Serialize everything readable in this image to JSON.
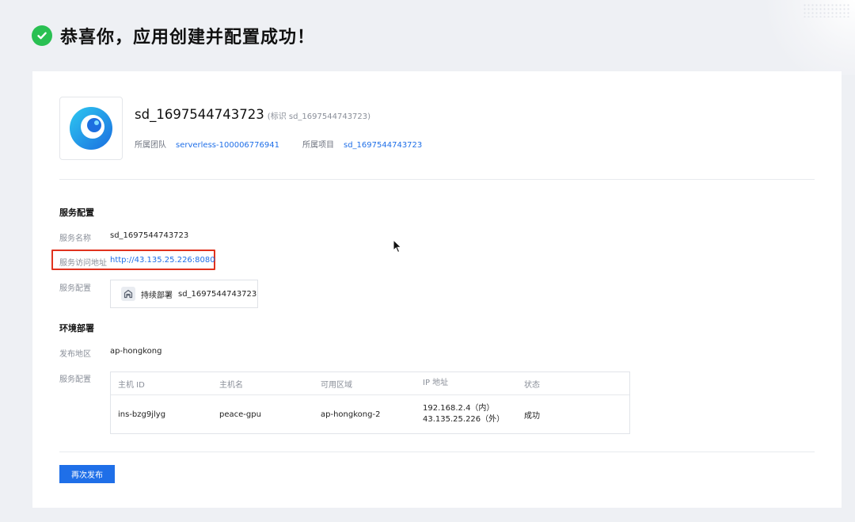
{
  "header": {
    "title": "恭喜你，应用创建并配置成功！"
  },
  "app": {
    "name": "sd_1697544743723",
    "id_text": "(标识 sd_1697544743723)",
    "team_label": "所属团队",
    "team_value": "serverless-100006776941",
    "project_label": "所属项目",
    "project_value": "sd_1697544743723"
  },
  "service": {
    "title": "服务配置",
    "name_label": "服务名称",
    "name_value": "sd_1697544743723",
    "url_label": "服务访问地址",
    "url_value": "http://43.135.25.226:8080",
    "config_label": "服务配置",
    "deploy_label": "持续部署",
    "deploy_value": "sd_1697544743723"
  },
  "env": {
    "title": "环境部署",
    "region_label": "发布地区",
    "region_value": "ap-hongkong",
    "config_label": "服务配置",
    "table": {
      "headers": [
        "主机 ID",
        "主机名",
        "可用区域",
        "IP 地址",
        "状态"
      ],
      "row": {
        "id": "ins-bzg9jlyg",
        "hostname": "peace-gpu",
        "zone": "ap-hongkong-2",
        "ip_inner": "192.168.2.4（内）",
        "ip_outer": "43.135.25.226（外）",
        "status": "成功"
      }
    }
  },
  "actions": {
    "publish_label": "再次发布"
  },
  "colors": {
    "success": "#29c052",
    "link": "#1f6fe8",
    "highlight": "#e0321e"
  },
  "icons": [
    "check-circle-icon",
    "app-logo-icon",
    "deploy-icon",
    "mouse-cursor-icon"
  ]
}
